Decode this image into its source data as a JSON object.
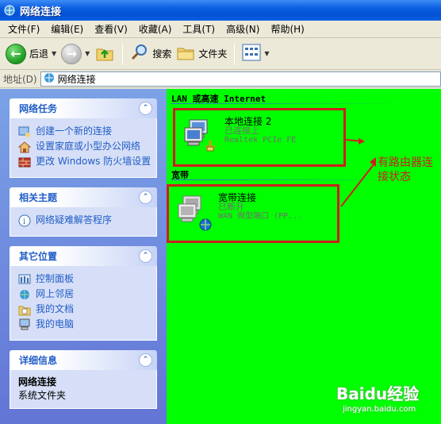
{
  "window": {
    "title": "网络连接"
  },
  "menu": [
    "文件(F)",
    "编辑(E)",
    "查看(V)",
    "收藏(A)",
    "工具(T)",
    "高级(N)",
    "帮助(H)"
  ],
  "toolbar": {
    "back": "后退",
    "search": "搜索",
    "folders": "文件夹"
  },
  "address": {
    "label": "地址(D)",
    "value": "网络连接"
  },
  "taskpane": {
    "network_tasks": {
      "title": "网络任务",
      "items": [
        "创建一个新的连接",
        "设置家庭或小型办公网络",
        "更改 Windows 防火墙设置"
      ]
    },
    "related": {
      "title": "相关主题",
      "items": [
        "网络疑难解答程序"
      ]
    },
    "other_places": {
      "title": "其它位置",
      "items": [
        "控制面板",
        "网上邻居",
        "我的文档",
        "我的电脑"
      ]
    },
    "details": {
      "title": "详细信息",
      "name": "网络连接",
      "type": "系统文件夹"
    }
  },
  "main": {
    "lan_group": "LAN 或高速 Internet",
    "broadband_group": "宽带",
    "lan_conn": {
      "name": "本地连接 2",
      "status": "已连接上",
      "device": "Realtek PCIe FE"
    },
    "wan_conn": {
      "name": "宽带连接",
      "status": "已断开",
      "device": "WAN 微型端口 (PP..."
    },
    "annotation": "有路由器连接状态"
  },
  "watermark": {
    "brand": "Baidu经验",
    "url": "jingyan.baidu.com"
  },
  "colors": {
    "main_bg": "#00ff00",
    "annotation": "#cc1f1f",
    "link": "#215dc6"
  }
}
